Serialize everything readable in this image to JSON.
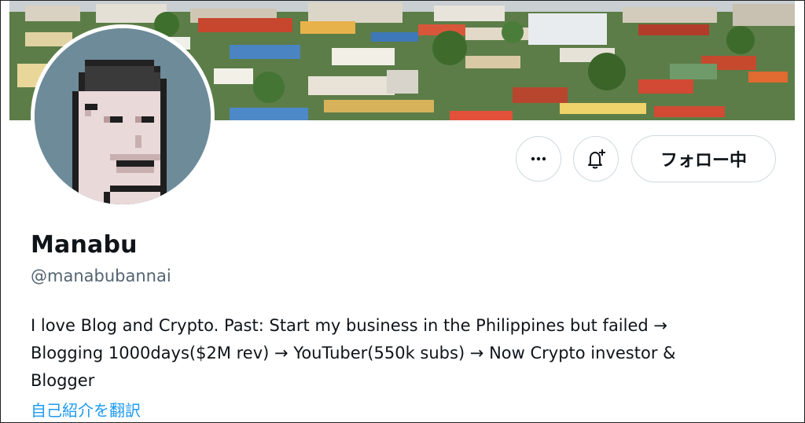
{
  "profile": {
    "display_name": "Manabu",
    "handle": "@manabubannai",
    "bio_lines": [
      "I love Blog and Crypto. Past: Start my business in the Philippines but failed →",
      "Blogging 1000days($2M rev) → YouTuber(550k subs) → Now Crypto investor &",
      "Blogger"
    ],
    "translate_link": "自己紹介を翻訳"
  },
  "actions": {
    "more_icon": "more-horizontal-icon",
    "notify_icon": "bell-plus-icon",
    "follow_label": "フォロー中"
  },
  "banner": {
    "description_icon": "city-photo"
  },
  "avatar": {
    "icon": "pixel-punk-avatar"
  },
  "colors": {
    "link": "#1d9bf0",
    "text_primary": "#0f1419",
    "text_secondary": "#536471",
    "border": "#cfd9de",
    "avatar_bg": "#6e8b9a"
  }
}
